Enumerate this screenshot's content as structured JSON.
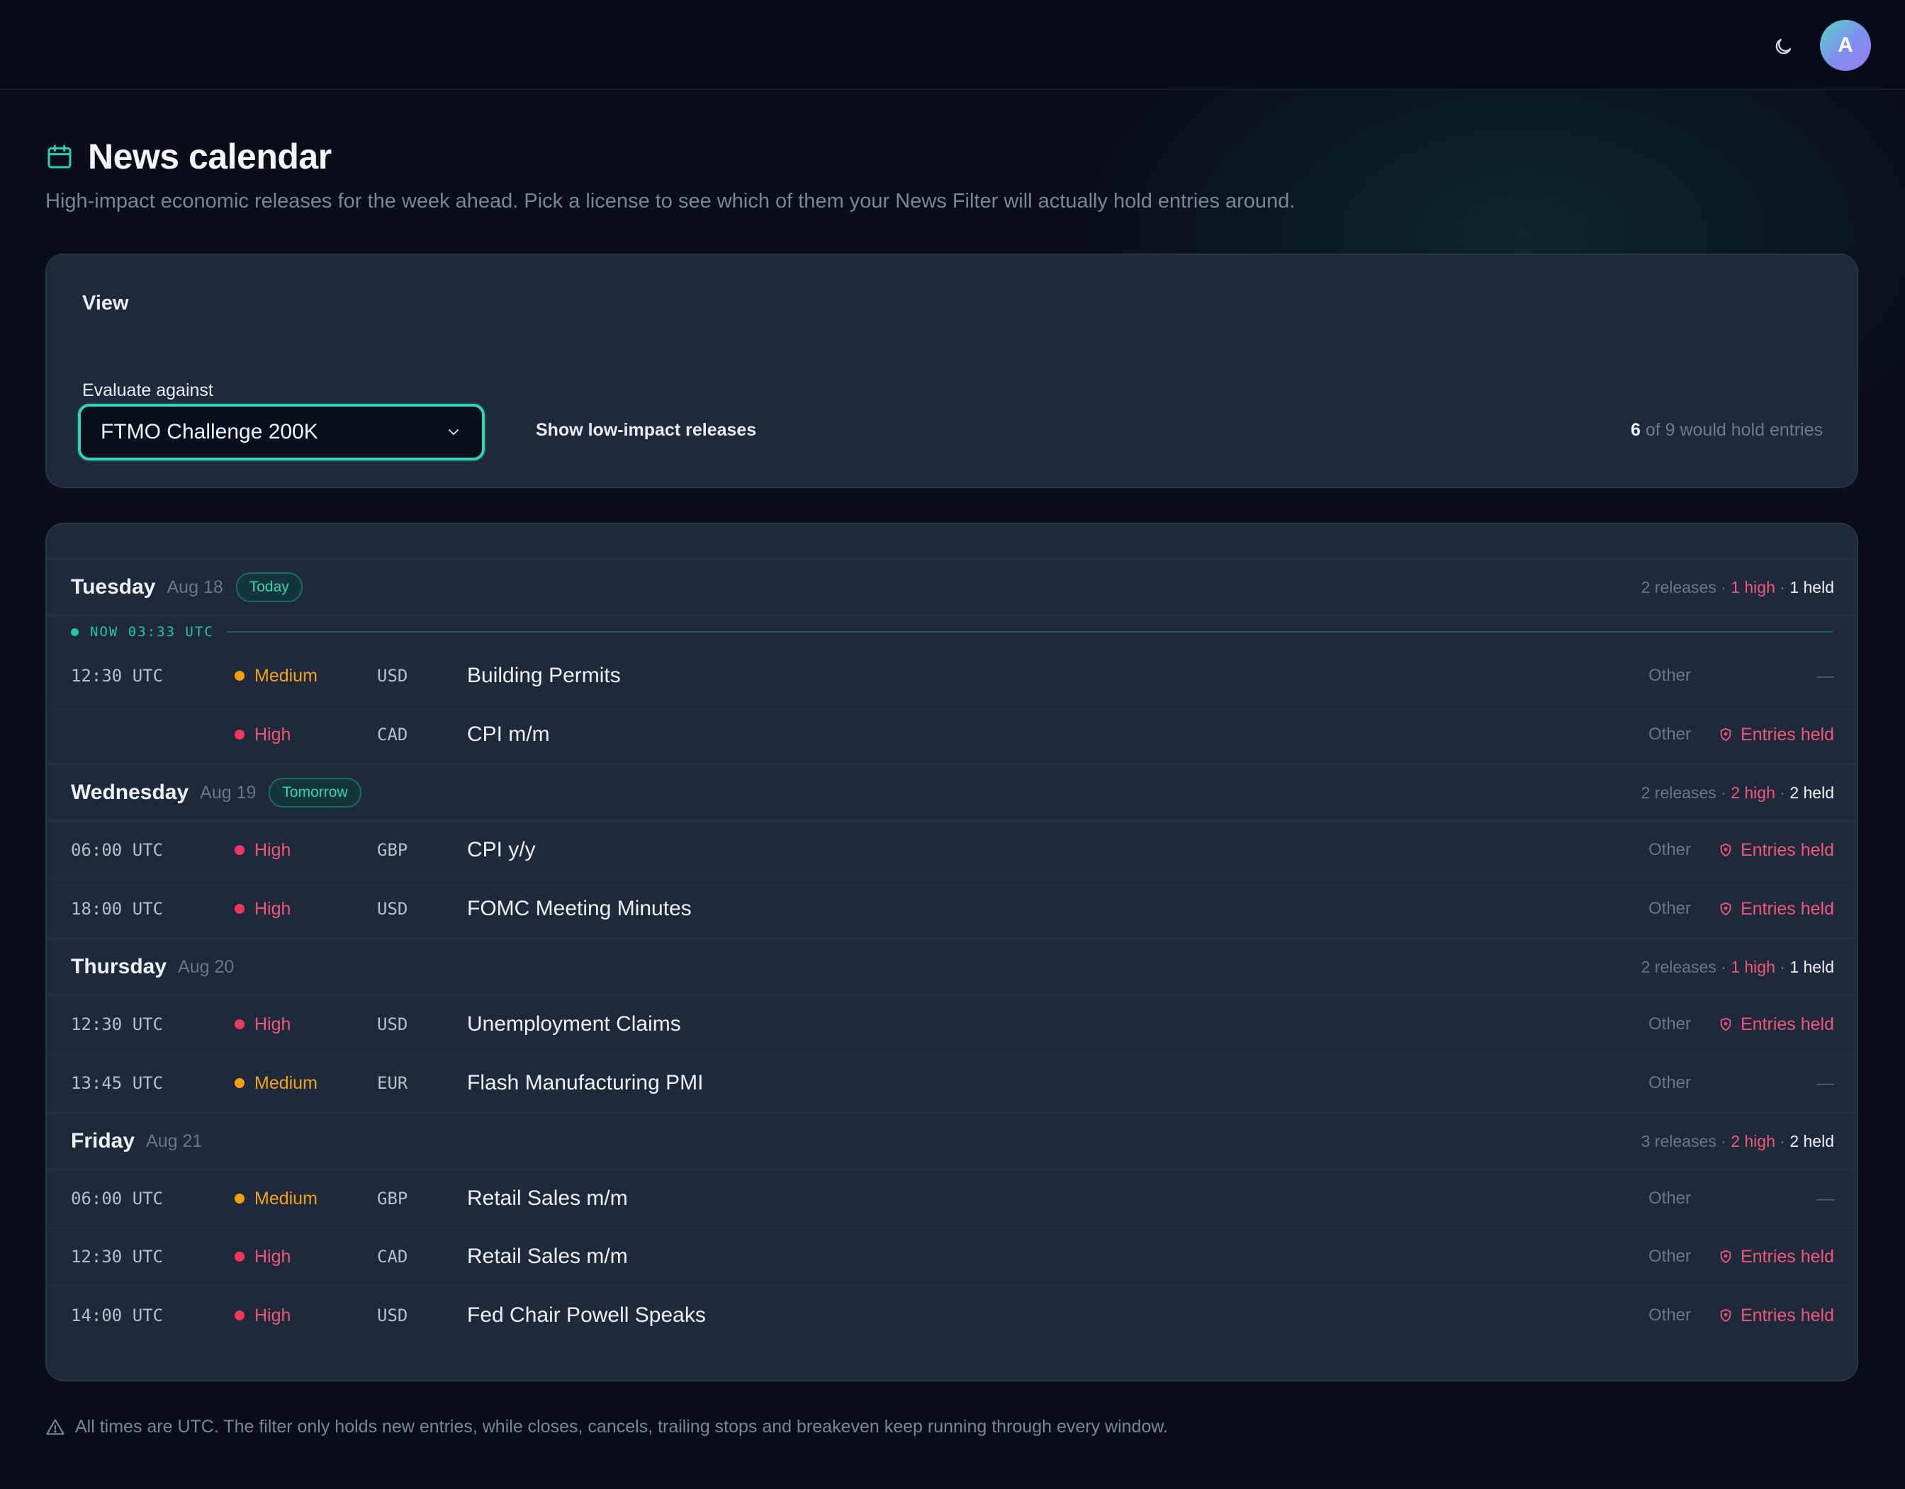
{
  "header": {
    "avatar_initial": "A",
    "theme_icon": "moon-icon"
  },
  "page": {
    "title": "News calendar",
    "subtitle": "High-impact economic releases for the week ahead. Pick a license to see which of them your News Filter will actually hold entries around."
  },
  "view": {
    "label": "View",
    "evaluate_label": "Evaluate against",
    "selected_license": "FTMO Challenge 200K",
    "toggle_label": "Show low-impact releases",
    "summary_count": "6",
    "summary_text": "of 9 would hold entries"
  },
  "now": {
    "label": "NOW 03:33 UTC"
  },
  "days": [
    {
      "name": "Tuesday",
      "date": "Aug 18",
      "badge": "Today",
      "releases": "2 releases",
      "high": "1 high",
      "held": "1 held",
      "events": [
        {
          "time": "12:30 UTC",
          "impact": "Medium",
          "currency": "USD",
          "event": "Building Permits",
          "category": "Other",
          "status": "—"
        },
        {
          "time": "",
          "impact": "High",
          "currency": "CAD",
          "event": "CPI m/m",
          "category": "Other",
          "status": "Entries held"
        }
      ]
    },
    {
      "name": "Wednesday",
      "date": "Aug 19",
      "badge": "Tomorrow",
      "releases": "2 releases",
      "high": "2 high",
      "held": "2 held",
      "events": [
        {
          "time": "06:00 UTC",
          "impact": "High",
          "currency": "GBP",
          "event": "CPI y/y",
          "category": "Other",
          "status": "Entries held"
        },
        {
          "time": "18:00 UTC",
          "impact": "High",
          "currency": "USD",
          "event": "FOMC Meeting Minutes",
          "category": "Other",
          "status": "Entries held"
        }
      ]
    },
    {
      "name": "Thursday",
      "date": "Aug 20",
      "badge": "",
      "releases": "2 releases",
      "high": "1 high",
      "held": "1 held",
      "events": [
        {
          "time": "12:30 UTC",
          "impact": "High",
          "currency": "USD",
          "event": "Unemployment Claims",
          "category": "Other",
          "status": "Entries held"
        },
        {
          "time": "13:45 UTC",
          "impact": "Medium",
          "currency": "EUR",
          "event": "Flash Manufacturing PMI",
          "category": "Other",
          "status": "—"
        }
      ]
    },
    {
      "name": "Friday",
      "date": "Aug 21",
      "badge": "",
      "releases": "3 releases",
      "high": "2 high",
      "held": "2 held",
      "events": [
        {
          "time": "06:00 UTC",
          "impact": "Medium",
          "currency": "GBP",
          "event": "Retail Sales m/m",
          "category": "Other",
          "status": "—"
        },
        {
          "time": "12:30 UTC",
          "impact": "High",
          "currency": "CAD",
          "event": "Retail Sales m/m",
          "category": "Other",
          "status": "Entries held"
        },
        {
          "time": "14:00 UTC",
          "impact": "High",
          "currency": "USD",
          "event": "Fed Chair Powell Speaks",
          "category": "Other",
          "status": "Entries held"
        }
      ]
    }
  ],
  "footer": {
    "note": "All times are UTC. The filter only holds new entries, while closes, cancels, trailing stops and breakeven keep running through every window."
  },
  "colors": {
    "accent": "#34d3b9",
    "high": "#f0375f",
    "medium": "#f59e0b",
    "card": "#1e293b",
    "background": "#0a0e1a"
  }
}
